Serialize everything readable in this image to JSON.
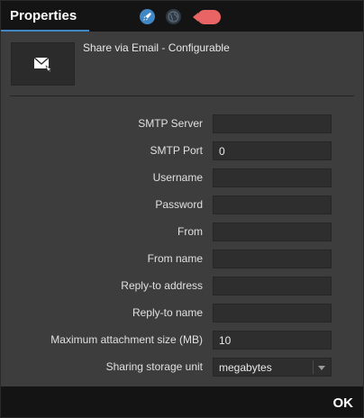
{
  "header": {
    "tab_label": "Properties",
    "icons": [
      "rocket-icon",
      "globe-icon",
      "tag-icon"
    ],
    "accent_color": "#3f88c5",
    "tag_color": "#e96565"
  },
  "component": {
    "title": "Share via Email - Configurable",
    "icon": "email-icon"
  },
  "fields": {
    "smtp_server": {
      "label": "SMTP Server",
      "value": ""
    },
    "smtp_port": {
      "label": "SMTP Port",
      "value": "0"
    },
    "username": {
      "label": "Username",
      "value": ""
    },
    "password": {
      "label": "Password",
      "value": ""
    },
    "from": {
      "label": "From",
      "value": ""
    },
    "from_name": {
      "label": "From name",
      "value": ""
    },
    "reply_to_address": {
      "label": "Reply-to address",
      "value": ""
    },
    "reply_to_name": {
      "label": "Reply-to name",
      "value": ""
    },
    "max_attachment": {
      "label": "Maximum attachment size (MB)",
      "value": "10"
    },
    "storage_unit": {
      "label": "Sharing storage unit",
      "value": "megabytes"
    }
  },
  "footer": {
    "ok_label": "OK"
  }
}
